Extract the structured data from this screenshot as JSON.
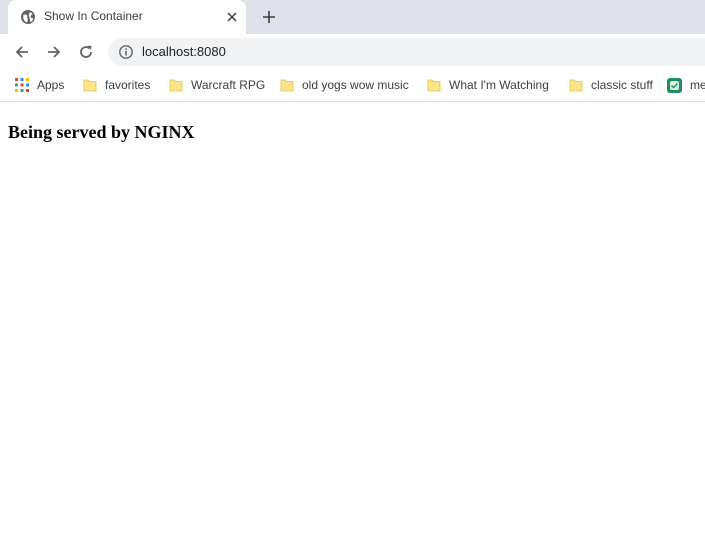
{
  "tab": {
    "title": "Show In Container",
    "favicon": "globe-icon",
    "close_icon": "close-icon"
  },
  "new_tab": {
    "icon": "plus-icon"
  },
  "toolbar": {
    "back_icon": "back-arrow-icon",
    "forward_icon": "forward-arrow-icon",
    "reload_icon": "reload-icon",
    "site_info_icon": "info-icon",
    "url": "localhost:8080"
  },
  "bookmarks": [
    {
      "label": "Apps",
      "icon": "apps-grid-icon"
    },
    {
      "label": "favorites",
      "icon": "folder-icon"
    },
    {
      "label": "Warcraft RPG",
      "icon": "folder-icon"
    },
    {
      "label": "old yogs wow music",
      "icon": "folder-icon"
    },
    {
      "label": "What I'm Watching",
      "icon": "folder-icon"
    },
    {
      "label": "classic stuff",
      "icon": "folder-icon"
    },
    {
      "label": "me",
      "icon": "site-favicon-icon"
    }
  ],
  "page": {
    "heading": "Being served by NGINX"
  },
  "colors": {
    "tabstrip": "#dee1e6",
    "omnibox": "#f1f3f4",
    "folder": "#fbe58a",
    "icon": "#5f6368"
  }
}
